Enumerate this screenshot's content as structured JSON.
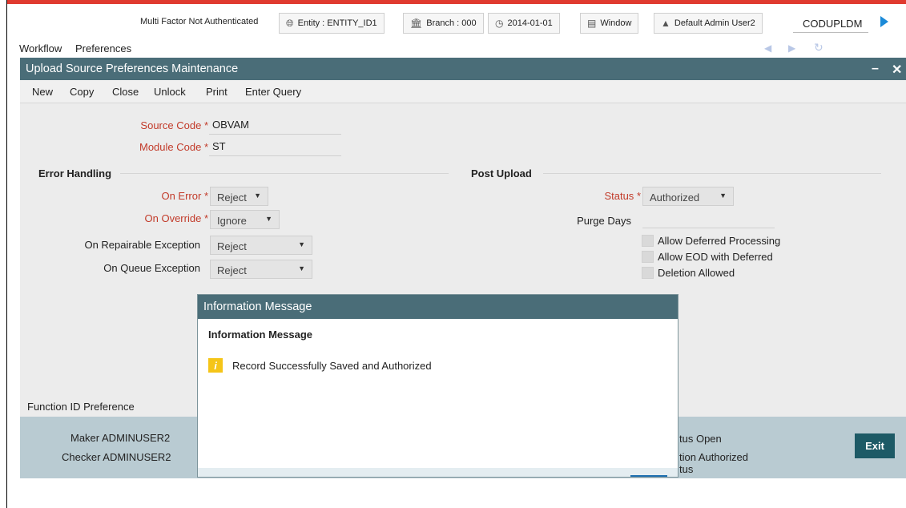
{
  "topbar": {
    "mfa_status": "Multi Factor Not Authenticated",
    "entity": "Entity : ENTITY_ID1",
    "branch": "Branch : 000",
    "date": "2014-01-01",
    "window": "Window",
    "user": "Default Admin User2",
    "function_input": "CODUPLDM"
  },
  "menu": {
    "workflow": "Workflow",
    "preferences": "Preferences"
  },
  "window": {
    "title": "Upload Source Preferences Maintenance",
    "minimize": "–",
    "close": "✕"
  },
  "toolbar": {
    "new": "New",
    "copy": "Copy",
    "close": "Close",
    "unlock": "Unlock",
    "print": "Print",
    "enter_query": "Enter Query"
  },
  "form": {
    "source_code_label": "Source Code",
    "source_code_value": "OBVAM",
    "module_code_label": "Module Code",
    "module_code_value": "ST",
    "required_mark": "*",
    "error_handling": {
      "heading": "Error Handling",
      "on_error_label": "On Error",
      "on_error_value": "Reject",
      "on_override_label": "On Override",
      "on_override_value": "Ignore",
      "on_repairable_label": "On Repairable Exception",
      "on_repairable_value": "Reject",
      "on_queue_label": "On Queue Exception",
      "on_queue_value": "Reject"
    },
    "post_upload": {
      "heading": "Post Upload",
      "status_label": "Status",
      "status_value": "Authorized",
      "purge_days_label": "Purge Days",
      "allow_deferred": "Allow Deferred Processing",
      "allow_eod": "Allow EOD with Deferred",
      "deletion_allowed": "Deletion Allowed"
    }
  },
  "function_id_preference": "Function ID Preference",
  "audit": {
    "maker": "Maker ADMINUSER2",
    "checker": "Checker ADMINUSER2",
    "record_status": "tus Open",
    "auth_status": "tion Authorized",
    "auth_status_tail": "tus"
  },
  "exit_label": "Exit",
  "dialog": {
    "title": "Information Message",
    "heading": "Information Message",
    "icon_glyph": "i",
    "message": "Record Successfully Saved and Authorized"
  },
  "colors": {
    "accent_red": "#e03a2f",
    "header_teal": "#4a6d78",
    "exit_button": "#1d5a66",
    "required_red": "#c23b2a",
    "info_yellow": "#f5c518"
  }
}
